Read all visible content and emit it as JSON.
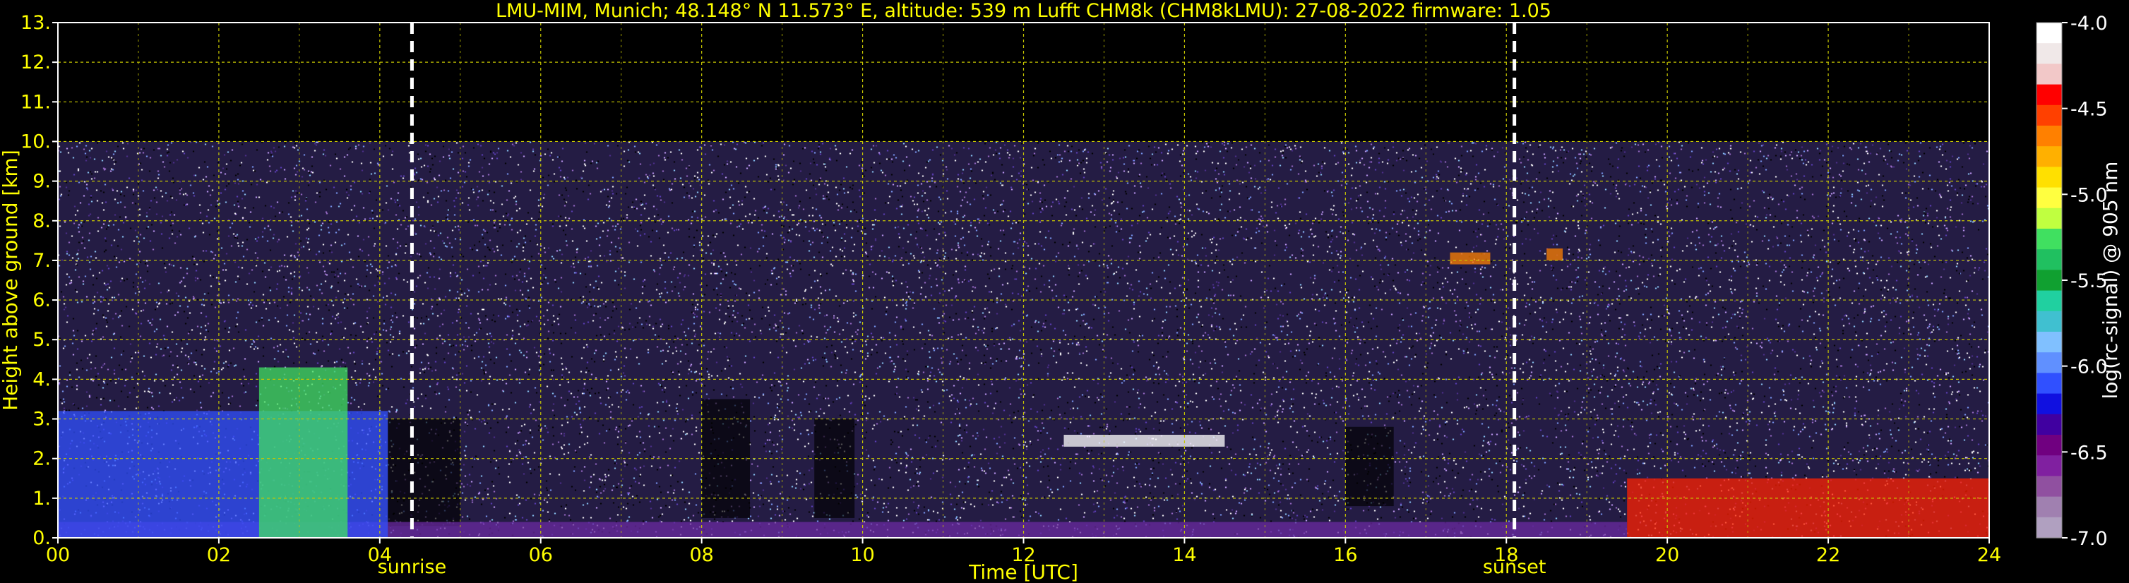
{
  "chart_data": {
    "type": "heatmap",
    "title": "LMU-MIM, Munich; 48.148° N 11.573° E, altitude: 539 m    Lufft CHM8k (CHM8kLMU): 27-08-2022    firmware: 1.05",
    "xlabel": "Time [UTC]",
    "ylabel": "Height above ground [km]",
    "xlim": [
      0,
      24
    ],
    "ylim": [
      0,
      13
    ],
    "x_ticks": [
      "00",
      "02",
      "04",
      "06",
      "08",
      "10",
      "12",
      "14",
      "16",
      "18",
      "20",
      "22",
      "24"
    ],
    "y_ticks": [
      "0.",
      "1.",
      "2.",
      "3.",
      "4.",
      "5.",
      "6.",
      "7.",
      "8.",
      "9.",
      "10.",
      "11.",
      "12.",
      "13."
    ],
    "grid": true,
    "data_top_km": 10,
    "markers": [
      {
        "label": "sunrise",
        "time": 4.4
      },
      {
        "label": "sunset",
        "time": 18.1
      }
    ],
    "colorbar": {
      "label": "log(rc-signal) @ 905 nm",
      "range": [
        -7.0,
        -4.0
      ],
      "ticks": [
        "-4.0",
        "-4.5",
        "-5.0",
        "-5.5",
        "-6.0",
        "-6.5",
        "-7.0"
      ],
      "colors": [
        "#ffffff",
        "#f0e8e8",
        "#f2c8c8",
        "#ff0000",
        "#ff4000",
        "#ff8000",
        "#ffb000",
        "#ffe000",
        "#ffff40",
        "#c0ff40",
        "#40e060",
        "#20c060",
        "#10a030",
        "#20d0a0",
        "#40c0d0",
        "#80c0ff",
        "#6090ff",
        "#3050ff",
        "#1010e0",
        "#4000a0",
        "#700080",
        "#8020a0",
        "#9050a0",
        "#a080b0",
        "#b0a0c0"
      ]
    },
    "features": [
      {
        "name": "boundary layer (low)",
        "t_start": 0,
        "t_end": 19.5,
        "top_km": 0.4
      },
      {
        "name": "residual layer",
        "t_start": 0,
        "t_end": 4.1,
        "top_km": 3.2
      },
      {
        "name": "aerosol/cloud plume",
        "t_start": 2.5,
        "t_end": 3.6,
        "top_km": 4.3
      },
      {
        "name": "cloud layer",
        "t_start": 12.5,
        "t_end": 14.5,
        "top_km": 2.6
      },
      {
        "name": "thin high cloud",
        "t_start": 17.3,
        "t_end": 17.8,
        "top_km": 7.2
      },
      {
        "name": "thin high cloud",
        "t_start": 18.5,
        "t_end": 18.7,
        "top_km": 7.3
      },
      {
        "name": "nocturnal boundary layer",
        "t_start": 19.5,
        "t_end": 24,
        "top_km": 1.5
      }
    ]
  }
}
